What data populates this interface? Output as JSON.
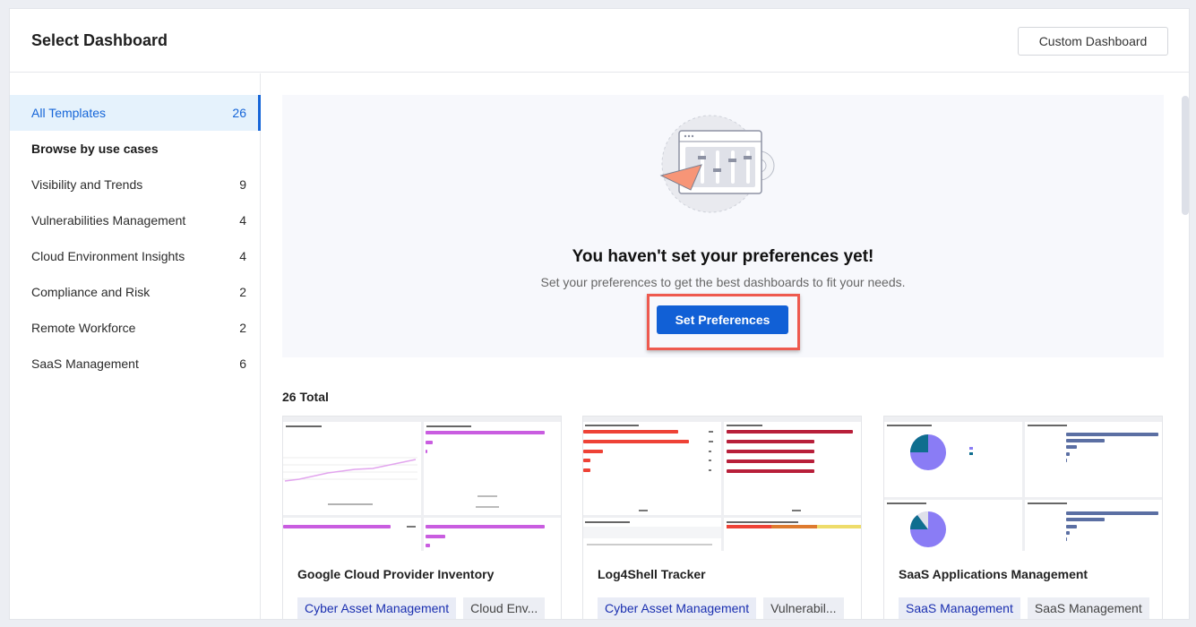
{
  "header": {
    "title": "Select Dashboard",
    "custom_dashboard_label": "Custom Dashboard"
  },
  "sidebar": {
    "all_templates": {
      "label": "All Templates",
      "count": "26"
    },
    "heading": "Browse by use cases",
    "items": [
      {
        "label": "Visibility and Trends",
        "count": "9"
      },
      {
        "label": "Vulnerabilities Management",
        "count": "4"
      },
      {
        "label": "Cloud Environment Insights",
        "count": "4"
      },
      {
        "label": "Compliance and Risk",
        "count": "2"
      },
      {
        "label": "Remote Workforce",
        "count": "2"
      },
      {
        "label": "SaaS Management",
        "count": "6"
      }
    ]
  },
  "preferences": {
    "title": "You haven't set your preferences yet!",
    "subtitle": "Set your preferences to get the best dashboards to fit your needs.",
    "button_label": "Set Preferences"
  },
  "templates": {
    "total_label": "26 Total",
    "cards": [
      {
        "title": "Google Cloud Provider Inventory",
        "tags": [
          "Cyber Asset Management",
          "Cloud Env..."
        ]
      },
      {
        "title": "Log4Shell Tracker",
        "tags": [
          "Cyber Asset Management",
          "Vulnerabil..."
        ]
      },
      {
        "title": "SaaS Applications Management",
        "tags": [
          "SaaS Management",
          "SaaS Management"
        ]
      }
    ]
  },
  "colors": {
    "accent": "#1160d6",
    "highlight": "#ee5a4f",
    "active_bg": "#e5f2fc",
    "preview_purple": "#c95de0",
    "preview_red": "#ee4236",
    "preview_crimson": "#b81f3a",
    "preview_slate": "#5b6fa3",
    "preview_violet": "#8a7cf5",
    "preview_teal": "#0f6e8f"
  }
}
